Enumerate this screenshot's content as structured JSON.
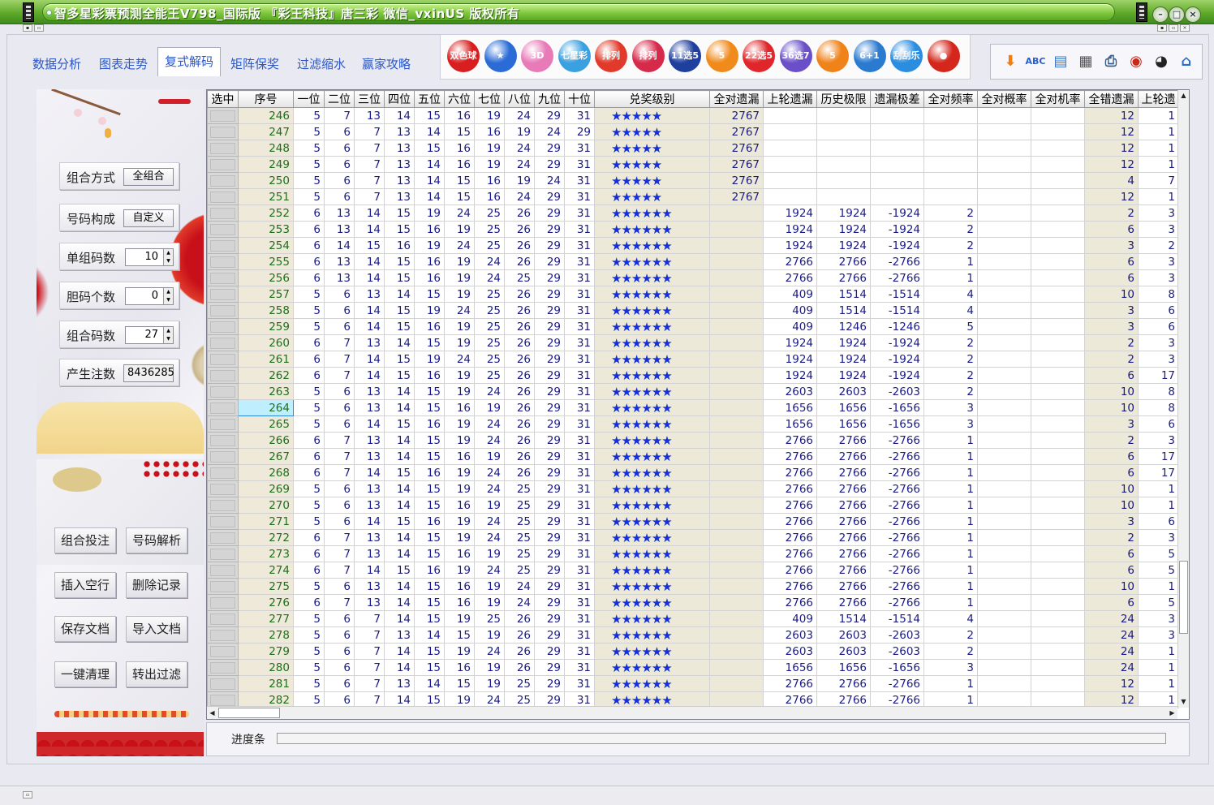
{
  "window": {
    "title": "智多星彩票预测全能王V798_国际版 『彩王科技』唐三彩 微信_vxinUS 版权所有",
    "controls": [
      "minimize",
      "restore",
      "close"
    ]
  },
  "tabs": [
    {
      "label": "数据分析",
      "active": false
    },
    {
      "label": "图表走势",
      "active": false
    },
    {
      "label": "复式解码",
      "active": true
    },
    {
      "label": "矩阵保奖",
      "active": false
    },
    {
      "label": "过滤缩水",
      "active": false
    },
    {
      "label": "赢家攻略",
      "active": false
    }
  ],
  "lotteries": [
    {
      "label": "双色球",
      "color": "#d81e1e"
    },
    {
      "label": "★",
      "color": "#2a6bd6"
    },
    {
      "label": "3D",
      "color": "#e87ab8"
    },
    {
      "label": "七星彩",
      "color": "#3aa0e0"
    },
    {
      "label": "排列",
      "color": "#e23a2a"
    },
    {
      "label": "排列",
      "color": "#d62a4a"
    },
    {
      "label": "11选5",
      "color": "#1f3f9f"
    },
    {
      "label": "5",
      "color": "#f08a1a"
    },
    {
      "label": "22选5",
      "color": "#e0262a"
    },
    {
      "label": "36选7",
      "color": "#6a4fc8"
    },
    {
      "label": "5",
      "color": "#f0821a"
    },
    {
      "label": "6+1",
      "color": "#2a7ad0"
    },
    {
      "label": "刮刮乐",
      "color": "#2a8de0"
    },
    {
      "label": "●",
      "color": "#d4261a"
    }
  ],
  "tools": [
    {
      "icon": "down-arrow-icon",
      "glyph": "⬇",
      "color": "#f07e10"
    },
    {
      "icon": "spellcheck-icon",
      "glyph": "ABC",
      "color": "#2a5fc8"
    },
    {
      "icon": "export-icon",
      "glyph": "▤",
      "color": "#3a78c8"
    },
    {
      "icon": "calculator-icon",
      "glyph": "▦",
      "color": "#555"
    },
    {
      "icon": "printer-icon",
      "glyph": "⎙",
      "color": "#3a5f8a"
    },
    {
      "icon": "lottery-machine-icon",
      "glyph": "◉",
      "color": "#c8281a"
    },
    {
      "icon": "qq-icon",
      "glyph": "◕",
      "color": "#222"
    },
    {
      "icon": "home-icon",
      "glyph": "⌂",
      "color": "#2a6fc8"
    }
  ],
  "params": [
    {
      "label": "组合方式",
      "value": "全组合",
      "kind": "button"
    },
    {
      "label": "号码构成",
      "value": "自定义",
      "kind": "button"
    },
    {
      "label": "单组码数",
      "value": "10",
      "kind": "spin"
    },
    {
      "label": "胆码个数",
      "value": "0",
      "kind": "spin"
    },
    {
      "label": "组合码数",
      "value": "27",
      "kind": "spin"
    },
    {
      "label": "产生注数",
      "value": "8436285",
      "kind": "plain"
    }
  ],
  "actions": [
    {
      "label": "组合投注"
    },
    {
      "label": "号码解析"
    },
    {
      "label": "插入空行"
    },
    {
      "label": "删除记录"
    },
    {
      "label": "保存文档"
    },
    {
      "label": "导入文档"
    },
    {
      "label": "一键清理"
    },
    {
      "label": "转出过滤"
    }
  ],
  "columns": [
    "选中",
    "序号",
    "一位",
    "二位",
    "三位",
    "四位",
    "五位",
    "六位",
    "七位",
    "八位",
    "九位",
    "十位",
    "兑奖级别",
    "全对遗漏",
    "上轮遗漏",
    "历史极限",
    "遗漏极差",
    "全对频率",
    "全对概率",
    "全对机率",
    "全错遗漏",
    "上轮遗"
  ],
  "rows": [
    {
      "seq": "246",
      "n": [
        "5",
        "7",
        "13",
        "14",
        "15",
        "16",
        "19",
        "24",
        "29",
        "31"
      ],
      "stars": "★★★★★",
      "qd": "2767",
      "sl": "",
      "ls": "",
      "yc": "",
      "pl": "",
      "gl": "",
      "jl": "",
      "cw": "12",
      "scw": "1"
    },
    {
      "seq": "247",
      "n": [
        "5",
        "6",
        "7",
        "13",
        "14",
        "15",
        "16",
        "19",
        "24",
        "29"
      ],
      "stars": "★★★★★",
      "qd": "2767",
      "sl": "",
      "ls": "",
      "yc": "",
      "pl": "",
      "gl": "",
      "jl": "",
      "cw": "12",
      "scw": "1"
    },
    {
      "seq": "248",
      "n": [
        "5",
        "6",
        "7",
        "13",
        "15",
        "16",
        "19",
        "24",
        "29",
        "31"
      ],
      "stars": "★★★★★",
      "qd": "2767",
      "sl": "",
      "ls": "",
      "yc": "",
      "pl": "",
      "gl": "",
      "jl": "",
      "cw": "12",
      "scw": "1"
    },
    {
      "seq": "249",
      "n": [
        "5",
        "6",
        "7",
        "13",
        "14",
        "16",
        "19",
        "24",
        "29",
        "31"
      ],
      "stars": "★★★★★",
      "qd": "2767",
      "sl": "",
      "ls": "",
      "yc": "",
      "pl": "",
      "gl": "",
      "jl": "",
      "cw": "12",
      "scw": "1"
    },
    {
      "seq": "250",
      "n": [
        "5",
        "6",
        "7",
        "13",
        "14",
        "15",
        "16",
        "19",
        "24",
        "31"
      ],
      "stars": "★★★★★",
      "qd": "2767",
      "sl": "",
      "ls": "",
      "yc": "",
      "pl": "",
      "gl": "",
      "jl": "",
      "cw": "4",
      "scw": "7"
    },
    {
      "seq": "251",
      "n": [
        "5",
        "6",
        "7",
        "13",
        "14",
        "15",
        "16",
        "24",
        "29",
        "31"
      ],
      "stars": "★★★★★",
      "qd": "2767",
      "sl": "",
      "ls": "",
      "yc": "",
      "pl": "",
      "gl": "",
      "jl": "",
      "cw": "12",
      "scw": "1"
    },
    {
      "seq": "252",
      "n": [
        "6",
        "13",
        "14",
        "15",
        "19",
        "24",
        "25",
        "26",
        "29",
        "31"
      ],
      "stars": "★★★★★★",
      "qd": "",
      "sl": "1924",
      "ls": "1924",
      "yc": "-1924",
      "pl": "2",
      "gl": "",
      "jl": "",
      "cw": "2",
      "scw": "3"
    },
    {
      "seq": "253",
      "n": [
        "6",
        "13",
        "14",
        "15",
        "16",
        "19",
        "25",
        "26",
        "29",
        "31"
      ],
      "stars": "★★★★★★",
      "qd": "",
      "sl": "1924",
      "ls": "1924",
      "yc": "-1924",
      "pl": "2",
      "gl": "",
      "jl": "",
      "cw": "6",
      "scw": "3"
    },
    {
      "seq": "254",
      "n": [
        "6",
        "14",
        "15",
        "16",
        "19",
        "24",
        "25",
        "26",
        "29",
        "31"
      ],
      "stars": "★★★★★★",
      "qd": "",
      "sl": "1924",
      "ls": "1924",
      "yc": "-1924",
      "pl": "2",
      "gl": "",
      "jl": "",
      "cw": "3",
      "scw": "2"
    },
    {
      "seq": "255",
      "n": [
        "6",
        "13",
        "14",
        "15",
        "16",
        "19",
        "24",
        "26",
        "29",
        "31"
      ],
      "stars": "★★★★★★",
      "qd": "",
      "sl": "2766",
      "ls": "2766",
      "yc": "-2766",
      "pl": "1",
      "gl": "",
      "jl": "",
      "cw": "6",
      "scw": "3"
    },
    {
      "seq": "256",
      "n": [
        "6",
        "13",
        "14",
        "15",
        "16",
        "19",
        "24",
        "25",
        "29",
        "31"
      ],
      "stars": "★★★★★★",
      "qd": "",
      "sl": "2766",
      "ls": "2766",
      "yc": "-2766",
      "pl": "1",
      "gl": "",
      "jl": "",
      "cw": "6",
      "scw": "3"
    },
    {
      "seq": "257",
      "n": [
        "5",
        "6",
        "13",
        "14",
        "15",
        "19",
        "25",
        "26",
        "29",
        "31"
      ],
      "stars": "★★★★★★",
      "qd": "",
      "sl": "409",
      "ls": "1514",
      "yc": "-1514",
      "pl": "4",
      "gl": "",
      "jl": "",
      "cw": "10",
      "scw": "8"
    },
    {
      "seq": "258",
      "n": [
        "5",
        "6",
        "14",
        "15",
        "19",
        "24",
        "25",
        "26",
        "29",
        "31"
      ],
      "stars": "★★★★★★",
      "qd": "",
      "sl": "409",
      "ls": "1514",
      "yc": "-1514",
      "pl": "4",
      "gl": "",
      "jl": "",
      "cw": "3",
      "scw": "6"
    },
    {
      "seq": "259",
      "n": [
        "5",
        "6",
        "14",
        "15",
        "16",
        "19",
        "25",
        "26",
        "29",
        "31"
      ],
      "stars": "★★★★★★",
      "qd": "",
      "sl": "409",
      "ls": "1246",
      "yc": "-1246",
      "pl": "5",
      "gl": "",
      "jl": "",
      "cw": "3",
      "scw": "6"
    },
    {
      "seq": "260",
      "n": [
        "6",
        "7",
        "13",
        "14",
        "15",
        "19",
        "25",
        "26",
        "29",
        "31"
      ],
      "stars": "★★★★★★",
      "qd": "",
      "sl": "1924",
      "ls": "1924",
      "yc": "-1924",
      "pl": "2",
      "gl": "",
      "jl": "",
      "cw": "2",
      "scw": "3"
    },
    {
      "seq": "261",
      "n": [
        "6",
        "7",
        "14",
        "15",
        "19",
        "24",
        "25",
        "26",
        "29",
        "31"
      ],
      "stars": "★★★★★★",
      "qd": "",
      "sl": "1924",
      "ls": "1924",
      "yc": "-1924",
      "pl": "2",
      "gl": "",
      "jl": "",
      "cw": "2",
      "scw": "3"
    },
    {
      "seq": "262",
      "n": [
        "6",
        "7",
        "14",
        "15",
        "16",
        "19",
        "25",
        "26",
        "29",
        "31"
      ],
      "stars": "★★★★★★",
      "qd": "",
      "sl": "1924",
      "ls": "1924",
      "yc": "-1924",
      "pl": "2",
      "gl": "",
      "jl": "",
      "cw": "6",
      "scw": "17"
    },
    {
      "seq": "263",
      "n": [
        "5",
        "6",
        "13",
        "14",
        "15",
        "19",
        "24",
        "26",
        "29",
        "31"
      ],
      "stars": "★★★★★★",
      "qd": "",
      "sl": "2603",
      "ls": "2603",
      "yc": "-2603",
      "pl": "2",
      "gl": "",
      "jl": "",
      "cw": "10",
      "scw": "8"
    },
    {
      "seq": "264",
      "n": [
        "5",
        "6",
        "13",
        "14",
        "15",
        "16",
        "19",
        "26",
        "29",
        "31"
      ],
      "stars": "★★★★★★",
      "qd": "",
      "sl": "1656",
      "ls": "1656",
      "yc": "-1656",
      "pl": "3",
      "gl": "",
      "jl": "",
      "cw": "10",
      "scw": "8",
      "hl": true
    },
    {
      "seq": "265",
      "n": [
        "5",
        "6",
        "14",
        "15",
        "16",
        "19",
        "24",
        "26",
        "29",
        "31"
      ],
      "stars": "★★★★★★",
      "qd": "",
      "sl": "1656",
      "ls": "1656",
      "yc": "-1656",
      "pl": "3",
      "gl": "",
      "jl": "",
      "cw": "3",
      "scw": "6"
    },
    {
      "seq": "266",
      "n": [
        "6",
        "7",
        "13",
        "14",
        "15",
        "19",
        "24",
        "26",
        "29",
        "31"
      ],
      "stars": "★★★★★★",
      "qd": "",
      "sl": "2766",
      "ls": "2766",
      "yc": "-2766",
      "pl": "1",
      "gl": "",
      "jl": "",
      "cw": "2",
      "scw": "3"
    },
    {
      "seq": "267",
      "n": [
        "6",
        "7",
        "13",
        "14",
        "15",
        "16",
        "19",
        "26",
        "29",
        "31"
      ],
      "stars": "★★★★★★",
      "qd": "",
      "sl": "2766",
      "ls": "2766",
      "yc": "-2766",
      "pl": "1",
      "gl": "",
      "jl": "",
      "cw": "6",
      "scw": "17"
    },
    {
      "seq": "268",
      "n": [
        "6",
        "7",
        "14",
        "15",
        "16",
        "19",
        "24",
        "26",
        "29",
        "31"
      ],
      "stars": "★★★★★★",
      "qd": "",
      "sl": "2766",
      "ls": "2766",
      "yc": "-2766",
      "pl": "1",
      "gl": "",
      "jl": "",
      "cw": "6",
      "scw": "17"
    },
    {
      "seq": "269",
      "n": [
        "5",
        "6",
        "13",
        "14",
        "15",
        "19",
        "24",
        "25",
        "29",
        "31"
      ],
      "stars": "★★★★★★",
      "qd": "",
      "sl": "2766",
      "ls": "2766",
      "yc": "-2766",
      "pl": "1",
      "gl": "",
      "jl": "",
      "cw": "10",
      "scw": "1"
    },
    {
      "seq": "270",
      "n": [
        "5",
        "6",
        "13",
        "14",
        "15",
        "16",
        "19",
        "25",
        "29",
        "31"
      ],
      "stars": "★★★★★★",
      "qd": "",
      "sl": "2766",
      "ls": "2766",
      "yc": "-2766",
      "pl": "1",
      "gl": "",
      "jl": "",
      "cw": "10",
      "scw": "1"
    },
    {
      "seq": "271",
      "n": [
        "5",
        "6",
        "14",
        "15",
        "16",
        "19",
        "24",
        "25",
        "29",
        "31"
      ],
      "stars": "★★★★★★",
      "qd": "",
      "sl": "2766",
      "ls": "2766",
      "yc": "-2766",
      "pl": "1",
      "gl": "",
      "jl": "",
      "cw": "3",
      "scw": "6"
    },
    {
      "seq": "272",
      "n": [
        "6",
        "7",
        "13",
        "14",
        "15",
        "19",
        "24",
        "25",
        "29",
        "31"
      ],
      "stars": "★★★★★★",
      "qd": "",
      "sl": "2766",
      "ls": "2766",
      "yc": "-2766",
      "pl": "1",
      "gl": "",
      "jl": "",
      "cw": "2",
      "scw": "3"
    },
    {
      "seq": "273",
      "n": [
        "6",
        "7",
        "13",
        "14",
        "15",
        "16",
        "19",
        "25",
        "29",
        "31"
      ],
      "stars": "★★★★★★",
      "qd": "",
      "sl": "2766",
      "ls": "2766",
      "yc": "-2766",
      "pl": "1",
      "gl": "",
      "jl": "",
      "cw": "6",
      "scw": "5"
    },
    {
      "seq": "274",
      "n": [
        "6",
        "7",
        "14",
        "15",
        "16",
        "19",
        "24",
        "25",
        "29",
        "31"
      ],
      "stars": "★★★★★★",
      "qd": "",
      "sl": "2766",
      "ls": "2766",
      "yc": "-2766",
      "pl": "1",
      "gl": "",
      "jl": "",
      "cw": "6",
      "scw": "5"
    },
    {
      "seq": "275",
      "n": [
        "5",
        "6",
        "13",
        "14",
        "15",
        "16",
        "19",
        "24",
        "29",
        "31"
      ],
      "stars": "★★★★★★",
      "qd": "",
      "sl": "2766",
      "ls": "2766",
      "yc": "-2766",
      "pl": "1",
      "gl": "",
      "jl": "",
      "cw": "10",
      "scw": "1"
    },
    {
      "seq": "276",
      "n": [
        "6",
        "7",
        "13",
        "14",
        "15",
        "16",
        "19",
        "24",
        "29",
        "31"
      ],
      "stars": "★★★★★★",
      "qd": "",
      "sl": "2766",
      "ls": "2766",
      "yc": "-2766",
      "pl": "1",
      "gl": "",
      "jl": "",
      "cw": "6",
      "scw": "5"
    },
    {
      "seq": "277",
      "n": [
        "5",
        "6",
        "7",
        "14",
        "15",
        "19",
        "25",
        "26",
        "29",
        "31"
      ],
      "stars": "★★★★★★",
      "qd": "",
      "sl": "409",
      "ls": "1514",
      "yc": "-1514",
      "pl": "4",
      "gl": "",
      "jl": "",
      "cw": "24",
      "scw": "3"
    },
    {
      "seq": "278",
      "n": [
        "5",
        "6",
        "7",
        "13",
        "14",
        "15",
        "19",
        "26",
        "29",
        "31"
      ],
      "stars": "★★★★★★",
      "qd": "",
      "sl": "2603",
      "ls": "2603",
      "yc": "-2603",
      "pl": "2",
      "gl": "",
      "jl": "",
      "cw": "24",
      "scw": "3"
    },
    {
      "seq": "279",
      "n": [
        "5",
        "6",
        "7",
        "14",
        "15",
        "19",
        "24",
        "26",
        "29",
        "31"
      ],
      "stars": "★★★★★★",
      "qd": "",
      "sl": "2603",
      "ls": "2603",
      "yc": "-2603",
      "pl": "2",
      "gl": "",
      "jl": "",
      "cw": "24",
      "scw": "1"
    },
    {
      "seq": "280",
      "n": [
        "5",
        "6",
        "7",
        "14",
        "15",
        "16",
        "19",
        "26",
        "29",
        "31"
      ],
      "stars": "★★★★★★",
      "qd": "",
      "sl": "1656",
      "ls": "1656",
      "yc": "-1656",
      "pl": "3",
      "gl": "",
      "jl": "",
      "cw": "24",
      "scw": "1"
    },
    {
      "seq": "281",
      "n": [
        "5",
        "6",
        "7",
        "13",
        "14",
        "15",
        "19",
        "25",
        "29",
        "31"
      ],
      "stars": "★★★★★★",
      "qd": "",
      "sl": "2766",
      "ls": "2766",
      "yc": "-2766",
      "pl": "1",
      "gl": "",
      "jl": "",
      "cw": "12",
      "scw": "1"
    },
    {
      "seq": "282",
      "n": [
        "5",
        "6",
        "7",
        "14",
        "15",
        "19",
        "24",
        "25",
        "29",
        "31"
      ],
      "stars": "★★★★★★",
      "qd": "",
      "sl": "2766",
      "ls": "2766",
      "yc": "-2766",
      "pl": "1",
      "gl": "",
      "jl": "",
      "cw": "12",
      "scw": "1"
    }
  ],
  "progress": {
    "label": "进度条",
    "value": 0
  }
}
